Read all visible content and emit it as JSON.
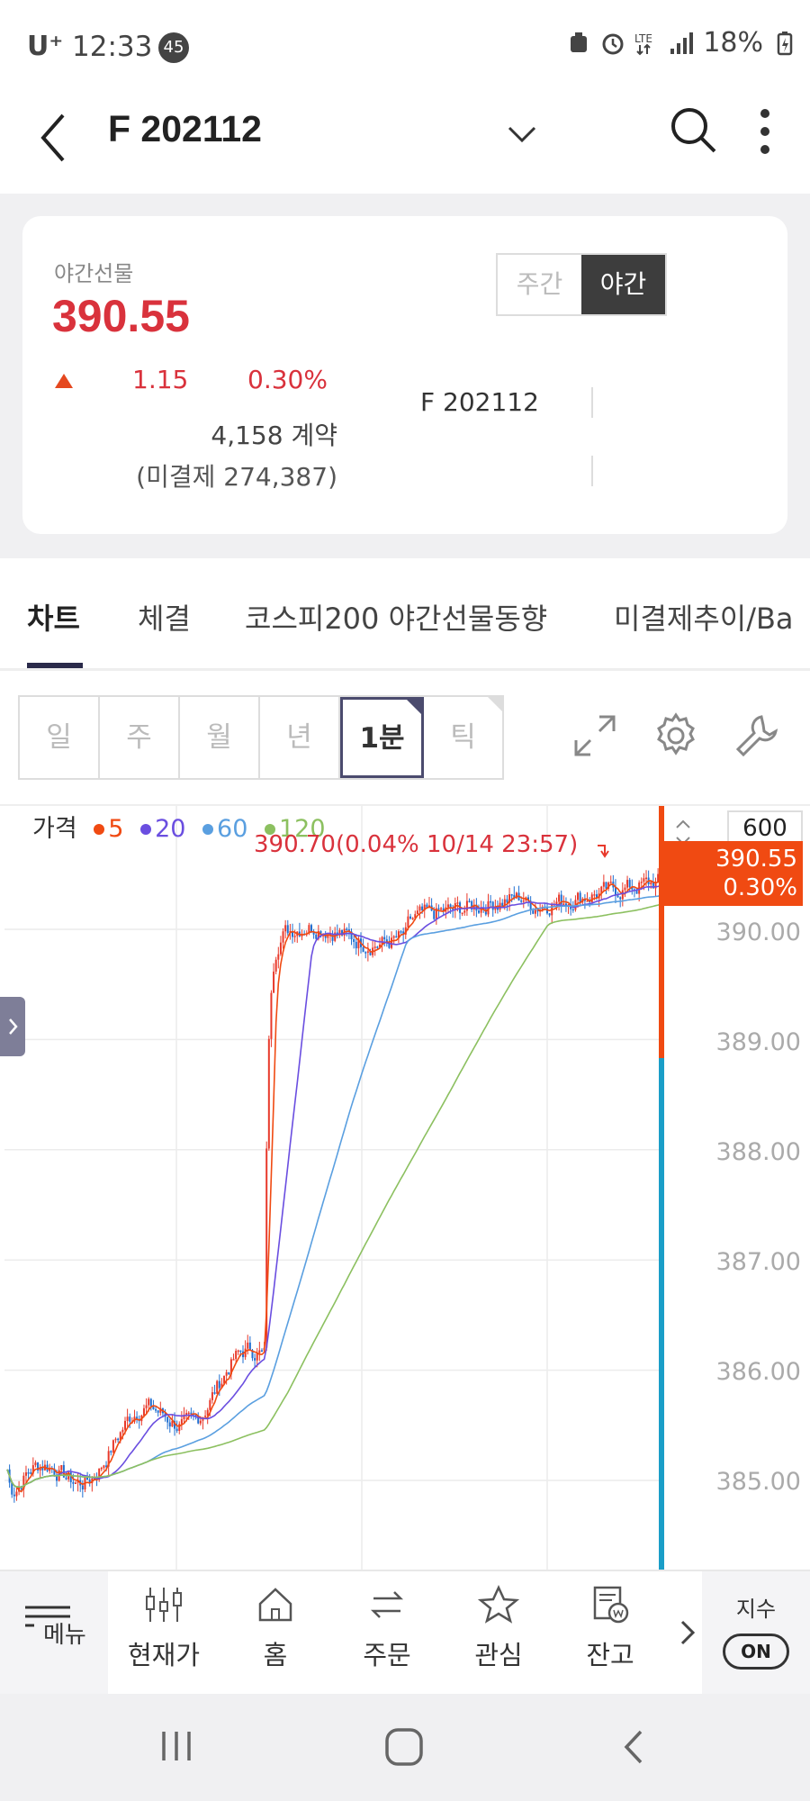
{
  "status_bar": {
    "carrier": "U⁺",
    "time": "12:33",
    "notification_count": "45",
    "battery": "18%"
  },
  "header": {
    "title": "F 202112"
  },
  "quote": {
    "label": "야간선물",
    "price": "390.55",
    "change": "1.15",
    "change_pct": "0.30%",
    "volume": "4,158 계약",
    "open_interest": "(미결제 274,387)",
    "code": "F 202112",
    "session_toggle": {
      "day": "주간",
      "night": "야간",
      "selected": "야간"
    }
  },
  "tabs": [
    {
      "label": "차트"
    },
    {
      "label": "체결"
    },
    {
      "label": "코스피200 야간선물동향"
    },
    {
      "label": "미결제추이/Ba"
    }
  ],
  "periods": [
    {
      "label": "일"
    },
    {
      "label": "주"
    },
    {
      "label": "월"
    },
    {
      "label": "년"
    },
    {
      "label": "1분"
    },
    {
      "label": "틱"
    }
  ],
  "chart_header": {
    "legend_title": "가격",
    "ma": [
      {
        "label": "5",
        "color": "#f04a12"
      },
      {
        "label": "20",
        "color": "#6a4ee0"
      },
      {
        "label": "60",
        "color": "#5a9fe0"
      },
      {
        "label": "120",
        "color": "#8cc060"
      }
    ],
    "note": "390.70(0.04% 10/14 23:57)",
    "count": "600",
    "current_price": "390.55",
    "current_pct": "0.30%"
  },
  "chart_data": {
    "type": "candlestick",
    "interval": "1분",
    "y_ticks": [
      "390.00",
      "389.00",
      "388.00",
      "387.00",
      "386.00",
      "385.00"
    ],
    "ylim": [
      384.3,
      390.9
    ],
    "last": 390.55,
    "high_marker": 390.7,
    "series": [
      {
        "name": "5",
        "color": "#f04a12"
      },
      {
        "name": "20",
        "color": "#6a4ee0"
      },
      {
        "name": "60",
        "color": "#5a9fe0"
      },
      {
        "name": "120",
        "color": "#8cc060"
      }
    ]
  },
  "bottom_nav": {
    "menu": "메뉴",
    "items": [
      {
        "label": "현재가"
      },
      {
        "label": "홈"
      },
      {
        "label": "주문"
      },
      {
        "label": "관심"
      },
      {
        "label": "잔고"
      }
    ],
    "index_label": "지수",
    "index_toggle": "ON"
  }
}
